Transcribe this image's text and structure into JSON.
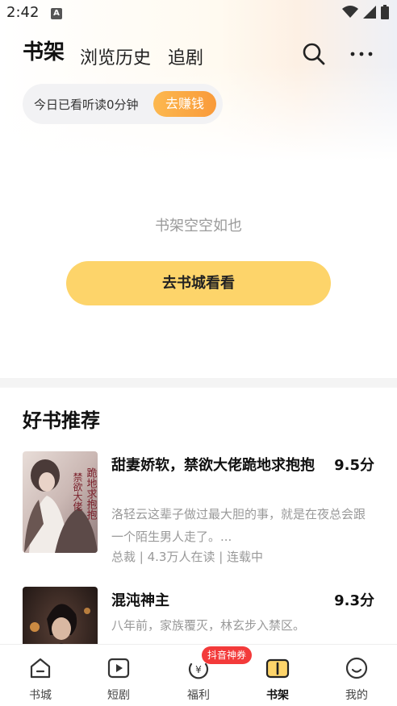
{
  "status_bar": {
    "time": "2:42",
    "notification_icon": "A"
  },
  "header": {
    "tabs": [
      {
        "label": "书架"
      },
      {
        "label": "浏览历史"
      },
      {
        "label": "追剧"
      }
    ],
    "search_icon": "search-icon",
    "more_icon": "more-icon"
  },
  "reading_banner": {
    "text": "今日已看听读0分钟",
    "button_label": "去赚钱"
  },
  "empty_state": {
    "message": "书架空空如也",
    "button_label": "去书城看看"
  },
  "recommendations": {
    "title": "好书推荐",
    "books": [
      {
        "title": "甜妻娇软，禁欲大佬跪地求抱抱",
        "score": "9.5分",
        "description": "洛轻云这辈子做过最大胆的事，就是在夜总会跟一个陌生男人走了。...",
        "meta": "总裁 | 4.3万人在读 | 连载中",
        "cover_text": "跪地求抱抱 禁欲大佬"
      },
      {
        "title": "混沌神主",
        "score": "9.3分",
        "description": "八年前，家族覆灭，林玄步入禁区。",
        "meta": ""
      }
    ]
  },
  "bottom_nav": {
    "items": [
      {
        "label": "书城",
        "icon": "home-icon"
      },
      {
        "label": "短剧",
        "icon": "play-icon"
      },
      {
        "label": "福利",
        "icon": "coin-icon"
      },
      {
        "label": "书架",
        "icon": "bookshelf-icon"
      },
      {
        "label": "我的",
        "icon": "profile-icon"
      }
    ],
    "badge": "抖音神券",
    "active_index": 3
  },
  "colors": {
    "accent_yellow": "#fdd46a",
    "earn_orange": "#f99a3a",
    "badge_red": "#f33a3a"
  }
}
